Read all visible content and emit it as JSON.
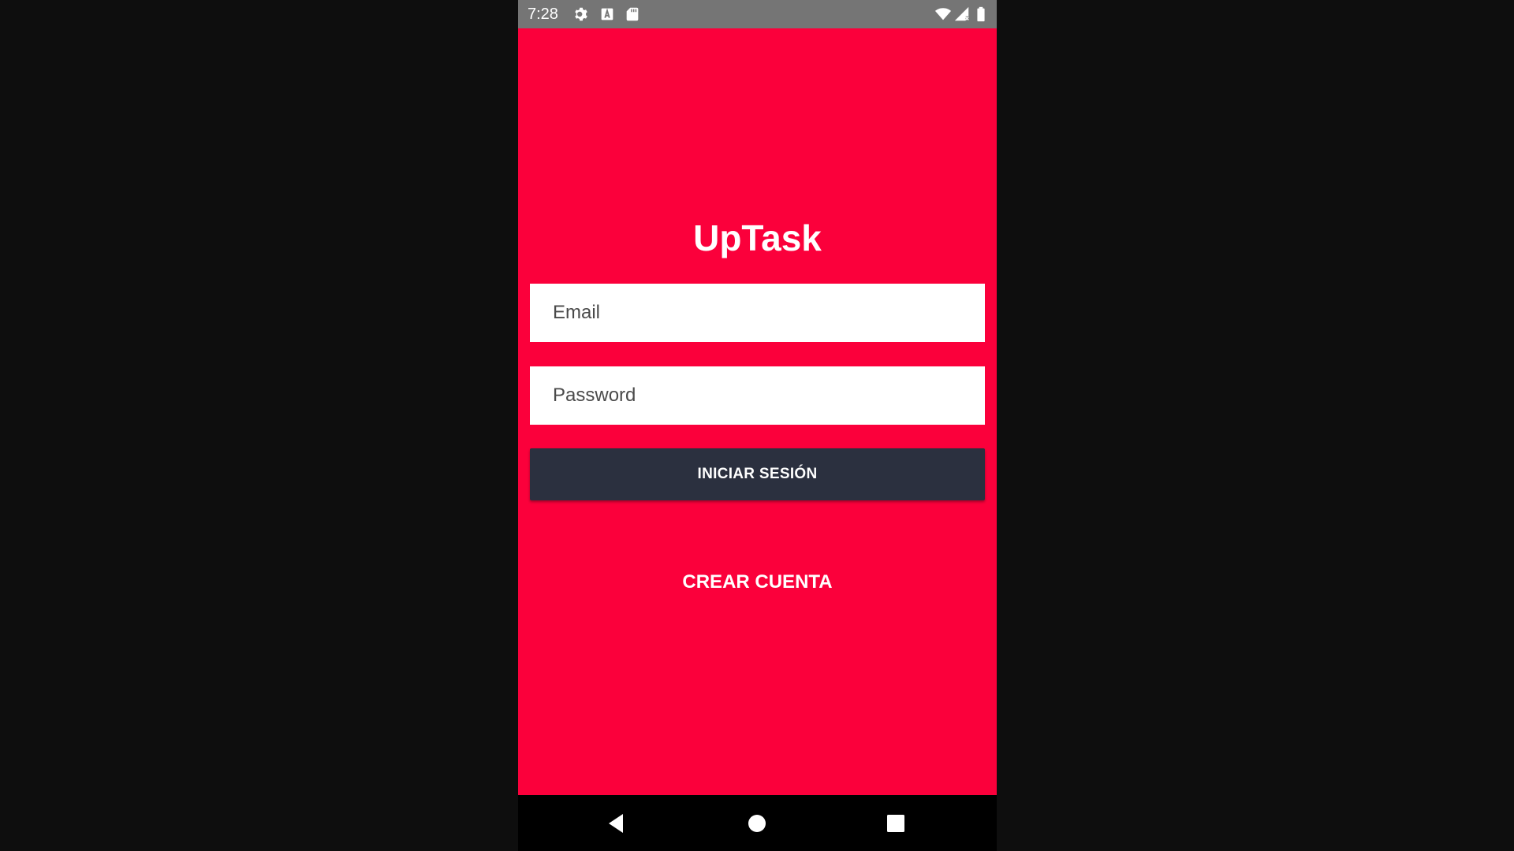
{
  "status_bar": {
    "time": "7:28",
    "icons_left": [
      "settings-icon",
      "keyboard-a-icon",
      "sd-card-icon"
    ],
    "icons_right": [
      "wifi-icon",
      "cell-signal-icon",
      "battery-icon"
    ]
  },
  "app": {
    "title": "UpTask",
    "background_color": "#fb003b"
  },
  "form": {
    "email_placeholder": "Email",
    "email_value": "",
    "password_placeholder": "Password",
    "password_value": "",
    "login_button_label": "INICIAR SESIÓN",
    "login_button_color": "#2b303f",
    "create_account_label": "CREAR CUENTA"
  },
  "nav_bar": {
    "buttons": [
      "back-icon",
      "home-icon",
      "recents-icon"
    ]
  }
}
